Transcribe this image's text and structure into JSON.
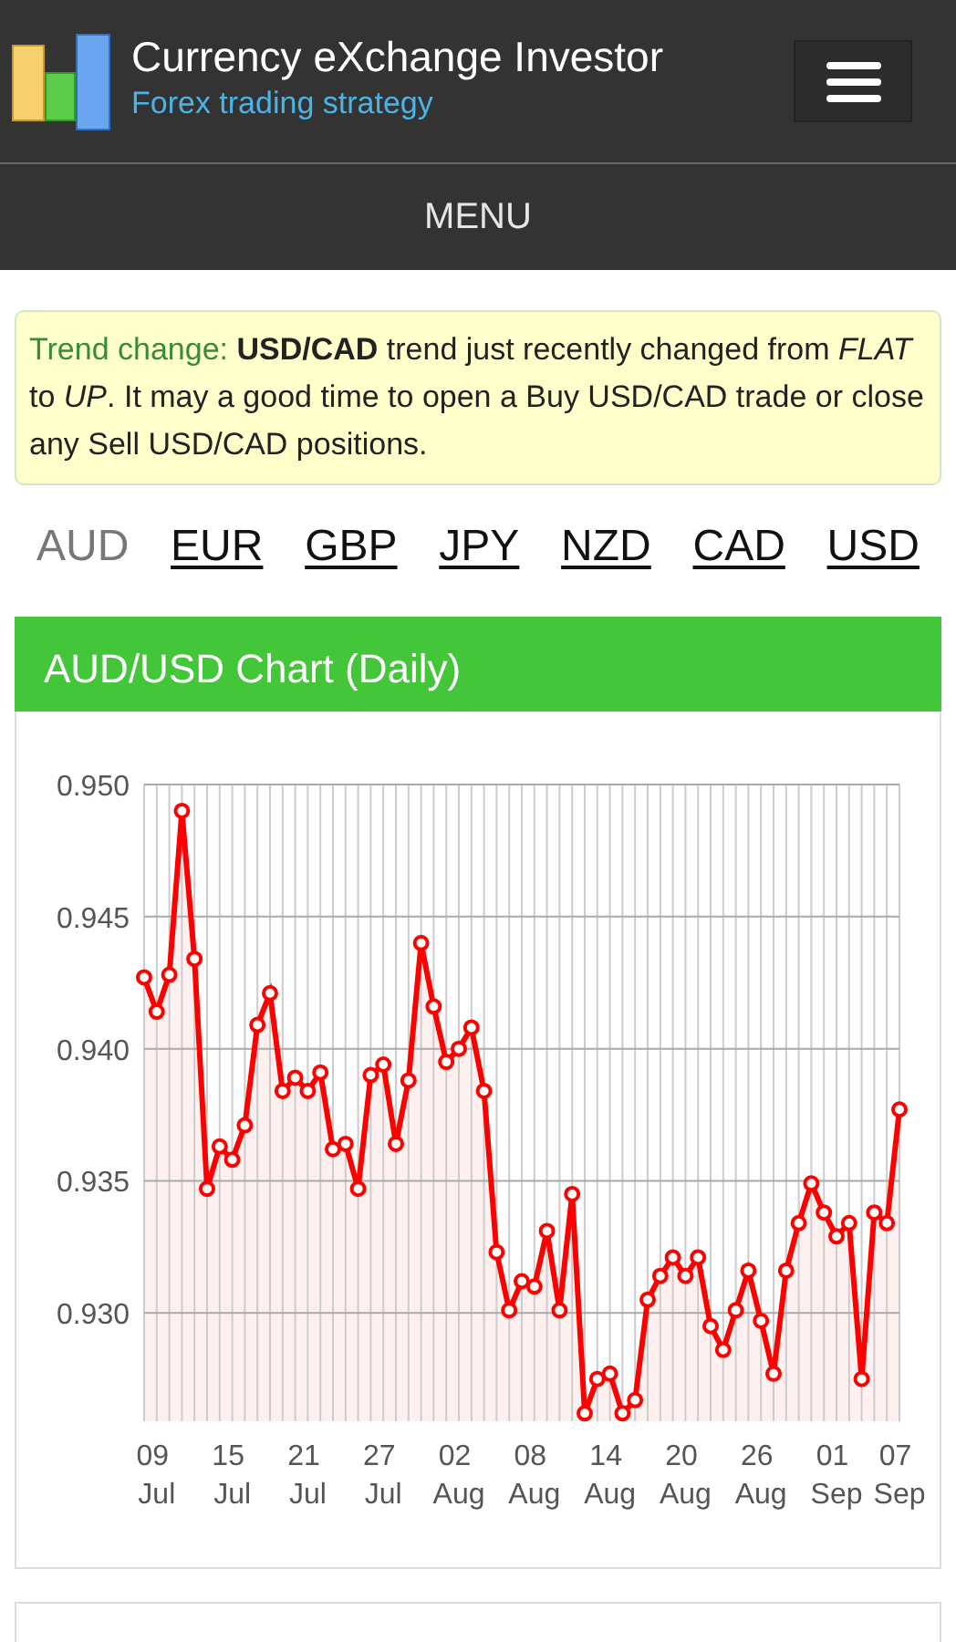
{
  "header": {
    "title": "Currency eXchange Investor",
    "subtitle": "Forex trading strategy"
  },
  "menu": {
    "label": "MENU"
  },
  "alert": {
    "label": "Trend change:",
    "message": "**USD/CAD** trend just recently changed from *FLAT* to *UP*. It may a good time to open a Buy USD/CAD trade or close any Sell USD/CAD positions."
  },
  "currencies": [
    {
      "label": "AUD",
      "selected": true
    },
    {
      "label": "EUR",
      "selected": false
    },
    {
      "label": "GBP",
      "selected": false
    },
    {
      "label": "JPY",
      "selected": false
    },
    {
      "label": "NZD",
      "selected": false
    },
    {
      "label": "CAD",
      "selected": false
    },
    {
      "label": "USD",
      "selected": false
    }
  ],
  "chart_panel": {
    "title": "AUD/USD Chart (Daily)",
    "chart_data": {
      "type": "area",
      "grid": true,
      "ylim": [
        0.9259,
        0.95
      ],
      "yticks": [
        {
          "value": 0.93,
          "label": "0.930"
        },
        {
          "value": 0.935,
          "label": "0.935"
        },
        {
          "value": 0.94,
          "label": "0.940"
        },
        {
          "value": 0.945,
          "label": "0.945"
        },
        {
          "value": 0.95,
          "label": "0.950"
        }
      ],
      "categories": [
        null,
        "09 Jul",
        null,
        null,
        null,
        null,
        null,
        "15 Jul",
        null,
        null,
        null,
        null,
        null,
        "21 Jul",
        null,
        null,
        null,
        null,
        null,
        "27 Jul",
        null,
        null,
        null,
        null,
        null,
        "02 Aug",
        null,
        null,
        null,
        null,
        null,
        "08 Aug",
        null,
        null,
        null,
        null,
        null,
        "14 Aug",
        null,
        null,
        null,
        null,
        null,
        "20 Aug",
        null,
        null,
        null,
        null,
        null,
        "26 Aug",
        null,
        null,
        null,
        null,
        null,
        "01 Sep",
        null,
        null,
        null,
        null,
        "07 Sep"
      ],
      "series": [
        {
          "color": "#ff0000",
          "marker": "circle",
          "values": [
            0.9427,
            0.9414,
            0.9428,
            0.949,
            0.9434,
            0.9347,
            0.9363,
            0.9358,
            0.9371,
            0.9409,
            0.9421,
            0.9384,
            0.9389,
            0.9384,
            0.9391,
            0.9362,
            0.9364,
            0.9347,
            0.939,
            0.9394,
            0.9364,
            0.9388,
            0.944,
            0.9416,
            0.9395,
            0.94,
            0.9408,
            0.9384,
            0.9323,
            0.9301,
            0.9312,
            0.931,
            0.9331,
            0.9301,
            0.9345,
            0.9262,
            0.9275,
            0.9277,
            0.9262,
            0.9267,
            0.9305,
            0.9314,
            0.9321,
            0.9314,
            0.9321,
            0.9295,
            0.9286,
            0.9301,
            0.9316,
            0.9297,
            0.9277,
            0.9316,
            0.9334,
            0.9349,
            0.9338,
            0.9329,
            0.9334,
            0.9275,
            0.9338,
            0.9334,
            0.9377
          ]
        }
      ]
    }
  }
}
